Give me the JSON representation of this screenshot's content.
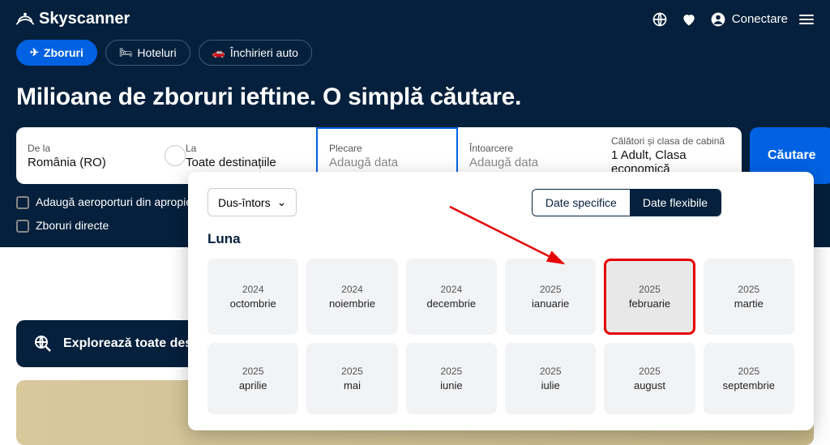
{
  "brand": "Skyscanner",
  "nav": {
    "login": "Conectare"
  },
  "tabs": {
    "flights": "Zboruri",
    "hotels": "Hoteluri",
    "cars": "Închirieri auto"
  },
  "headline": "Milioane de zboruri ieftine. O simplă căutare.",
  "search": {
    "from_label": "De la",
    "from_value": "România (RO)",
    "to_label": "La",
    "to_value": "Toate destinațiile",
    "depart_label": "Plecare",
    "depart_placeholder": "Adaugă data",
    "return_label": "Întoarcere",
    "return_placeholder": "Adaugă data",
    "pax_label": "Călători și clasa de cabină",
    "pax_value": "1 Adult, Clasa economică",
    "button": "Căutare"
  },
  "checks": {
    "nearby": "Adaugă aeroporturi din apropiere",
    "direct": "Zboruri directe"
  },
  "explore": "Explorează toate destina",
  "picker": {
    "trip": "Dus-întors",
    "specific": "Date specifice",
    "flexible": "Date flexibile",
    "section": "Luna",
    "months": [
      {
        "year": "2024",
        "name": "octombrie",
        "hl": false
      },
      {
        "year": "2024",
        "name": "noiembrie",
        "hl": false
      },
      {
        "year": "2024",
        "name": "decembrie",
        "hl": false
      },
      {
        "year": "2025",
        "name": "ianuarie",
        "hl": false
      },
      {
        "year": "2025",
        "name": "februarie",
        "hl": true
      },
      {
        "year": "2025",
        "name": "martie",
        "hl": false
      },
      {
        "year": "2025",
        "name": "aprilie",
        "hl": false
      },
      {
        "year": "2025",
        "name": "mai",
        "hl": false
      },
      {
        "year": "2025",
        "name": "iunie",
        "hl": false
      },
      {
        "year": "2025",
        "name": "iulie",
        "hl": false
      },
      {
        "year": "2025",
        "name": "august",
        "hl": false
      },
      {
        "year": "2025",
        "name": "septembrie",
        "hl": false
      }
    ]
  }
}
